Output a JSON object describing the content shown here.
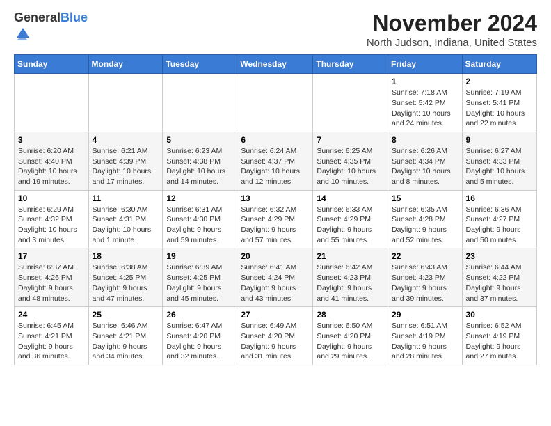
{
  "header": {
    "logo_general": "General",
    "logo_blue": "Blue",
    "month": "November 2024",
    "location": "North Judson, Indiana, United States"
  },
  "weekdays": [
    "Sunday",
    "Monday",
    "Tuesday",
    "Wednesday",
    "Thursday",
    "Friday",
    "Saturday"
  ],
  "weeks": [
    [
      {
        "day": "",
        "detail": ""
      },
      {
        "day": "",
        "detail": ""
      },
      {
        "day": "",
        "detail": ""
      },
      {
        "day": "",
        "detail": ""
      },
      {
        "day": "",
        "detail": ""
      },
      {
        "day": "1",
        "detail": "Sunrise: 7:18 AM\nSunset: 5:42 PM\nDaylight: 10 hours and 24 minutes."
      },
      {
        "day": "2",
        "detail": "Sunrise: 7:19 AM\nSunset: 5:41 PM\nDaylight: 10 hours and 22 minutes."
      }
    ],
    [
      {
        "day": "3",
        "detail": "Sunrise: 6:20 AM\nSunset: 4:40 PM\nDaylight: 10 hours and 19 minutes."
      },
      {
        "day": "4",
        "detail": "Sunrise: 6:21 AM\nSunset: 4:39 PM\nDaylight: 10 hours and 17 minutes."
      },
      {
        "day": "5",
        "detail": "Sunrise: 6:23 AM\nSunset: 4:38 PM\nDaylight: 10 hours and 14 minutes."
      },
      {
        "day": "6",
        "detail": "Sunrise: 6:24 AM\nSunset: 4:37 PM\nDaylight: 10 hours and 12 minutes."
      },
      {
        "day": "7",
        "detail": "Sunrise: 6:25 AM\nSunset: 4:35 PM\nDaylight: 10 hours and 10 minutes."
      },
      {
        "day": "8",
        "detail": "Sunrise: 6:26 AM\nSunset: 4:34 PM\nDaylight: 10 hours and 8 minutes."
      },
      {
        "day": "9",
        "detail": "Sunrise: 6:27 AM\nSunset: 4:33 PM\nDaylight: 10 hours and 5 minutes."
      }
    ],
    [
      {
        "day": "10",
        "detail": "Sunrise: 6:29 AM\nSunset: 4:32 PM\nDaylight: 10 hours and 3 minutes."
      },
      {
        "day": "11",
        "detail": "Sunrise: 6:30 AM\nSunset: 4:31 PM\nDaylight: 10 hours and 1 minute."
      },
      {
        "day": "12",
        "detail": "Sunrise: 6:31 AM\nSunset: 4:30 PM\nDaylight: 9 hours and 59 minutes."
      },
      {
        "day": "13",
        "detail": "Sunrise: 6:32 AM\nSunset: 4:29 PM\nDaylight: 9 hours and 57 minutes."
      },
      {
        "day": "14",
        "detail": "Sunrise: 6:33 AM\nSunset: 4:29 PM\nDaylight: 9 hours and 55 minutes."
      },
      {
        "day": "15",
        "detail": "Sunrise: 6:35 AM\nSunset: 4:28 PM\nDaylight: 9 hours and 52 minutes."
      },
      {
        "day": "16",
        "detail": "Sunrise: 6:36 AM\nSunset: 4:27 PM\nDaylight: 9 hours and 50 minutes."
      }
    ],
    [
      {
        "day": "17",
        "detail": "Sunrise: 6:37 AM\nSunset: 4:26 PM\nDaylight: 9 hours and 48 minutes."
      },
      {
        "day": "18",
        "detail": "Sunrise: 6:38 AM\nSunset: 4:25 PM\nDaylight: 9 hours and 47 minutes."
      },
      {
        "day": "19",
        "detail": "Sunrise: 6:39 AM\nSunset: 4:25 PM\nDaylight: 9 hours and 45 minutes."
      },
      {
        "day": "20",
        "detail": "Sunrise: 6:41 AM\nSunset: 4:24 PM\nDaylight: 9 hours and 43 minutes."
      },
      {
        "day": "21",
        "detail": "Sunrise: 6:42 AM\nSunset: 4:23 PM\nDaylight: 9 hours and 41 minutes."
      },
      {
        "day": "22",
        "detail": "Sunrise: 6:43 AM\nSunset: 4:23 PM\nDaylight: 9 hours and 39 minutes."
      },
      {
        "day": "23",
        "detail": "Sunrise: 6:44 AM\nSunset: 4:22 PM\nDaylight: 9 hours and 37 minutes."
      }
    ],
    [
      {
        "day": "24",
        "detail": "Sunrise: 6:45 AM\nSunset: 4:21 PM\nDaylight: 9 hours and 36 minutes."
      },
      {
        "day": "25",
        "detail": "Sunrise: 6:46 AM\nSunset: 4:21 PM\nDaylight: 9 hours and 34 minutes."
      },
      {
        "day": "26",
        "detail": "Sunrise: 6:47 AM\nSunset: 4:20 PM\nDaylight: 9 hours and 32 minutes."
      },
      {
        "day": "27",
        "detail": "Sunrise: 6:49 AM\nSunset: 4:20 PM\nDaylight: 9 hours and 31 minutes."
      },
      {
        "day": "28",
        "detail": "Sunrise: 6:50 AM\nSunset: 4:20 PM\nDaylight: 9 hours and 29 minutes."
      },
      {
        "day": "29",
        "detail": "Sunrise: 6:51 AM\nSunset: 4:19 PM\nDaylight: 9 hours and 28 minutes."
      },
      {
        "day": "30",
        "detail": "Sunrise: 6:52 AM\nSunset: 4:19 PM\nDaylight: 9 hours and 27 minutes."
      }
    ]
  ]
}
